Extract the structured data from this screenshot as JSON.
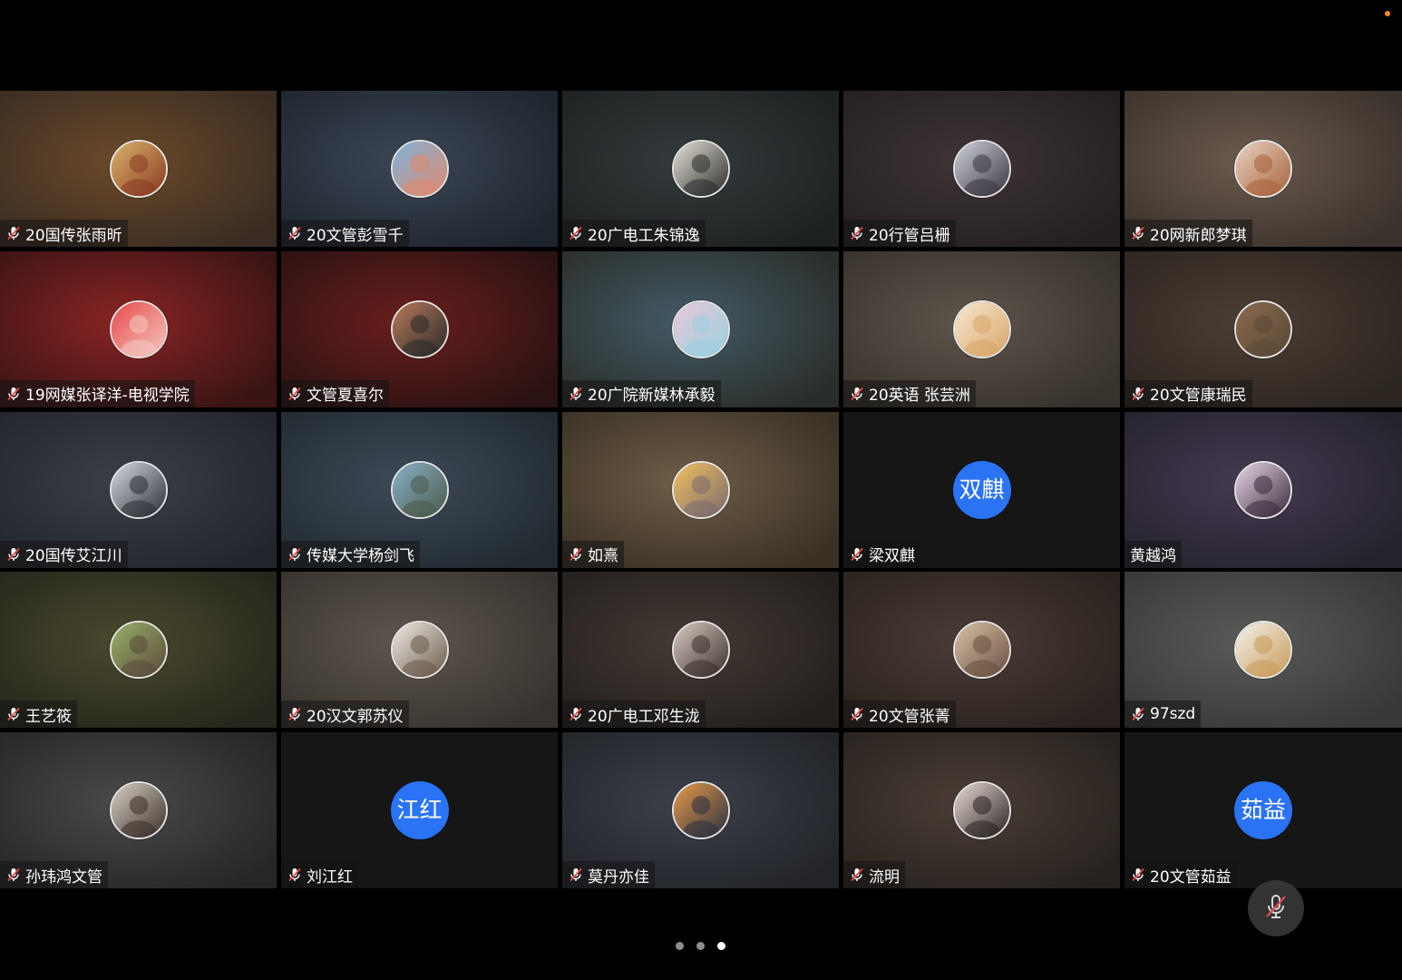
{
  "participants": [
    {
      "name": "20国传张雨昕",
      "muted": true,
      "avatar_text": "",
      "avatar_icon": "photo-avatar",
      "bg": [
        "#6b4a2a",
        "#3a2c22"
      ],
      "av": [
        "#d9b36a",
        "#8a3a22"
      ]
    },
    {
      "name": "20文管彭雪千",
      "muted": true,
      "avatar_text": "",
      "avatar_icon": "photo-avatar",
      "bg": [
        "#3c4656",
        "#1f252e"
      ],
      "av": [
        "#7fb3d9",
        "#e08a70"
      ]
    },
    {
      "name": "20广电工朱锦逸",
      "muted": true,
      "avatar_text": "",
      "avatar_icon": "photo-avatar",
      "bg": [
        "#343a3c",
        "#1e2122"
      ],
      "av": [
        "#e8e4d8",
        "#2a2a2a"
      ]
    },
    {
      "name": "20行管吕栅",
      "muted": true,
      "avatar_text": "",
      "avatar_icon": "photo-avatar",
      "bg": [
        "#3e3436",
        "#241f22"
      ],
      "av": [
        "#cfd3dc",
        "#3a3440"
      ]
    },
    {
      "name": "20网新郎梦琪",
      "muted": true,
      "avatar_text": "",
      "avatar_icon": "photo-avatar",
      "bg": [
        "#6b5a4e",
        "#3a322c"
      ],
      "av": [
        "#e8d2c4",
        "#a8623a"
      ]
    },
    {
      "name": "19网媒张译洋-电视学院",
      "muted": true,
      "avatar_text": "",
      "avatar_icon": "photo-avatar",
      "bg": [
        "#8a2424",
        "#3a1414"
      ],
      "av": [
        "#e84a4a",
        "#f4c8c0"
      ]
    },
    {
      "name": "文管夏喜尔",
      "muted": true,
      "avatar_text": "",
      "avatar_icon": "photo-avatar",
      "bg": [
        "#6a1e1e",
        "#2a1212"
      ],
      "av": [
        "#b87a5a",
        "#2a2a2a"
      ]
    },
    {
      "name": "20广院新媒林承毅",
      "muted": true,
      "avatar_text": "",
      "avatar_icon": "photo-avatar",
      "bg": [
        "#445a66",
        "#2a2e2a"
      ],
      "av": [
        "#e8c8d8",
        "#9ad0e0"
      ]
    },
    {
      "name": "20英语 张芸洲",
      "muted": true,
      "avatar_text": "",
      "avatar_icon": "photo-avatar",
      "bg": [
        "#5e554c",
        "#38322c"
      ],
      "av": [
        "#f6e8d0",
        "#d8a66a"
      ]
    },
    {
      "name": "20文管康瑞民",
      "muted": true,
      "avatar_text": "",
      "avatar_icon": "photo-avatar",
      "bg": [
        "#4c3e34",
        "#2c2520"
      ],
      "av": [
        "#8a6a4e",
        "#5a4836"
      ]
    },
    {
      "name": "20国传艾江川",
      "muted": true,
      "avatar_text": "",
      "avatar_icon": "photo-avatar",
      "bg": [
        "#3a4048",
        "#22262c"
      ],
      "av": [
        "#d8dce2",
        "#2a2e34"
      ]
    },
    {
      "name": "传媒大学杨剑飞",
      "muted": true,
      "avatar_text": "",
      "avatar_icon": "photo-avatar",
      "bg": [
        "#3e4a58",
        "#222a30"
      ],
      "av": [
        "#8ab0c8",
        "#4a5a4a"
      ]
    },
    {
      "name": "如熹",
      "muted": true,
      "avatar_text": "",
      "avatar_icon": "photo-avatar",
      "bg": [
        "#6e5e48",
        "#3a3024"
      ],
      "av": [
        "#f2c060",
        "#7a6a6e"
      ]
    },
    {
      "name": "梁双麒",
      "muted": true,
      "avatar_text": "双麒",
      "avatar_icon": "",
      "bg": [
        "#161616",
        "#161616"
      ],
      "av": [
        "#2b73f5",
        "#2b73f5"
      ]
    },
    {
      "name": "黄越鸿",
      "muted": false,
      "avatar_text": "",
      "avatar_icon": "photo-avatar",
      "bg": [
        "#463a52",
        "#25222c"
      ],
      "av": [
        "#e8d8e8",
        "#3a2a3a"
      ]
    },
    {
      "name": "王艺筱",
      "muted": true,
      "avatar_text": "",
      "avatar_icon": "photo-avatar",
      "bg": [
        "#4a4a2e",
        "#26261c"
      ],
      "av": [
        "#9ab06a",
        "#5a4a3a"
      ]
    },
    {
      "name": "20汉文郭苏仪",
      "muted": true,
      "avatar_text": "",
      "avatar_icon": "photo-avatar",
      "bg": [
        "#5e564e",
        "#38322e"
      ],
      "av": [
        "#f0ece6",
        "#6a5a4a"
      ]
    },
    {
      "name": "20广电工邓生泷",
      "muted": true,
      "avatar_text": "",
      "avatar_icon": "photo-avatar",
      "bg": [
        "#443a34",
        "#241f1c"
      ],
      "av": [
        "#d8ccc4",
        "#3a302a"
      ]
    },
    {
      "name": "20文管张菁",
      "muted": true,
      "avatar_text": "",
      "avatar_icon": "photo-avatar",
      "bg": [
        "#4a3c36",
        "#2a221e"
      ],
      "av": [
        "#d8c0a8",
        "#6a5040"
      ]
    },
    {
      "name": "97szd",
      "muted": true,
      "avatar_text": "",
      "avatar_icon": "photo-avatar",
      "bg": [
        "#5a5a58",
        "#383836"
      ],
      "av": [
        "#f4f2ec",
        "#c89a5a"
      ]
    },
    {
      "name": "孙玮鸿文管",
      "muted": true,
      "avatar_text": "",
      "avatar_icon": "photo-avatar",
      "bg": [
        "#4a4a4a",
        "#262626"
      ],
      "av": [
        "#d8d0c8",
        "#3a3028"
      ]
    },
    {
      "name": "刘江红",
      "muted": true,
      "avatar_text": "江红",
      "avatar_icon": "",
      "bg": [
        "#161616",
        "#161616"
      ],
      "av": [
        "#2b73f5",
        "#2b73f5"
      ]
    },
    {
      "name": "莫丹亦佳",
      "muted": true,
      "avatar_text": "",
      "avatar_icon": "photo-avatar",
      "bg": [
        "#3c4048",
        "#22242a"
      ],
      "av": [
        "#e89a4a",
        "#2a3040"
      ]
    },
    {
      "name": "流明",
      "muted": true,
      "avatar_text": "",
      "avatar_icon": "photo-avatar",
      "bg": [
        "#4a3e36",
        "#28221e"
      ],
      "av": [
        "#e8dcd4",
        "#2a2222"
      ]
    },
    {
      "name": "20文管茹益",
      "muted": true,
      "avatar_text": "茹益",
      "avatar_icon": "",
      "bg": [
        "#161616",
        "#161616"
      ],
      "av": [
        "#2b73f5",
        "#2b73f5"
      ]
    }
  ],
  "controls": {
    "mute_button_icon": "mic-off-icon"
  },
  "pager": {
    "pages": 3,
    "current": 3
  },
  "colors": {
    "accent": "#2b73f5",
    "status_dot": "#ff8a1f",
    "muted_mic": "#e64b4b"
  }
}
